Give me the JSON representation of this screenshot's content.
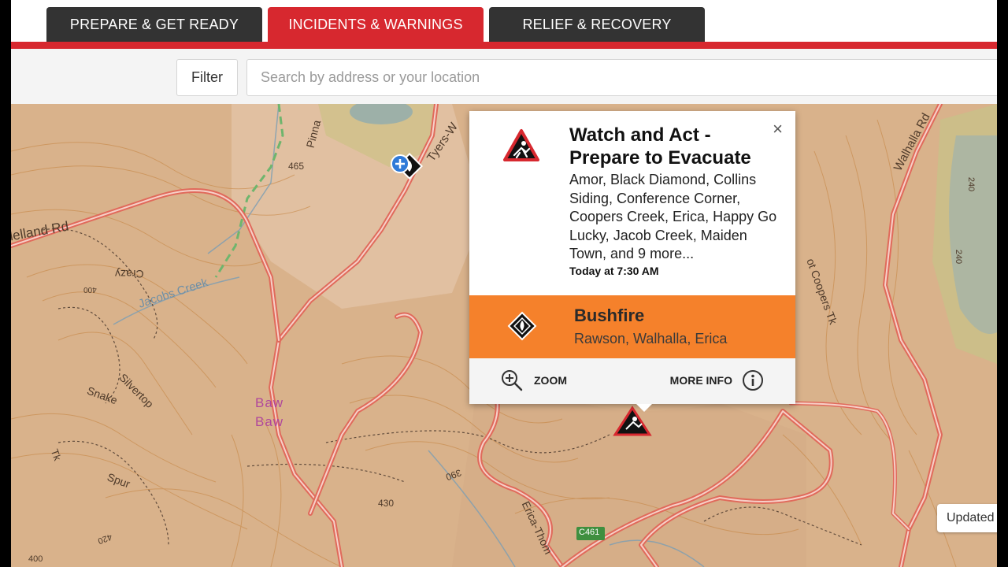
{
  "tabs": [
    {
      "label": "PREPARE & GET READY",
      "active": false
    },
    {
      "label": "INCIDENTS & WARNINGS",
      "active": true
    },
    {
      "label": "RELIEF & RECOVERY",
      "active": false
    }
  ],
  "search": {
    "filter_label": "Filter",
    "placeholder": "Search by address or your location"
  },
  "map": {
    "labels": {
      "clelland_rd": "lelland   Rd",
      "pinnak": "Pinna",
      "tyers": "Tyers-W",
      "walhalla_rd": "Walhalla Rd",
      "elev_465": "465",
      "crazy": "Crazy",
      "jacobs_creek": "Jacobs Creek",
      "elev_400a": "400",
      "silvertop": "Silvertop",
      "snake": "Snake",
      "tk": "Tk",
      "spur": "Spur",
      "baw1": "Baw",
      "baw2": "Baw",
      "elev_430": "430",
      "elev_390": "390",
      "erica_thom": "Erica-Thom",
      "c461": "C461",
      "coopers_tk": "ot Coopers Tk",
      "elev_240a": "240",
      "elev_240b": "240",
      "elev_400b": "400",
      "elev_420": "420"
    }
  },
  "popup": {
    "close_glyph": "×",
    "warning": {
      "title": "Watch and Act - Prepare to Evacuate",
      "places": "Amor, Black Diamond, Collins Siding, Conference Corner, Coopers Creek, Erica, Happy Go Lucky, Jacob Creek, Maiden Town, and 9 more...",
      "time": "Today at 7:30 AM"
    },
    "incident": {
      "type": "Bushfire",
      "places": "Rawson, Walhalla, Erica"
    },
    "actions": {
      "zoom": "ZOOM",
      "more_info": "MORE INFO"
    }
  },
  "updated_label": "Updated",
  "colors": {
    "brand_red": "#d7282f",
    "tab_dark": "#333333",
    "bushfire_orange": "#f5812b",
    "map_base": "#d8b088",
    "road": "#f07a6a"
  },
  "icons": [
    "warning-evacuate-icon",
    "bushfire-diamond-icon",
    "zoom-in-icon",
    "info-icon",
    "close-icon",
    "incident-marker-icon"
  ]
}
